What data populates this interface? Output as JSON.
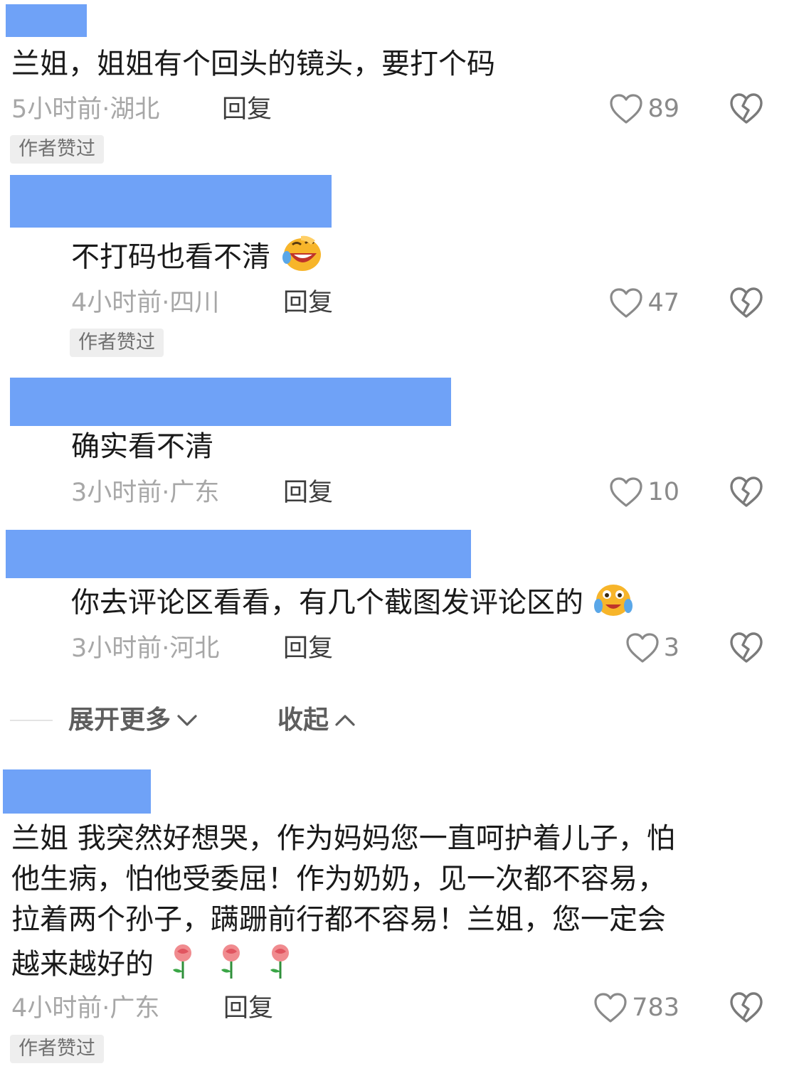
{
  "colors": {
    "redaction": "#6fa2f7",
    "meta_gray": "#a7a7a7",
    "badge_bg": "#eeeeee"
  },
  "comments": [
    {
      "text": "兰姐，姐姐有个回头的镜头，要打个码",
      "meta": "5小时前·湖北",
      "reply": "回复",
      "likes": "89",
      "badge": "作者赞过"
    },
    {
      "text": "不打码也看不清",
      "emoji": "rolling-laughing-emoji",
      "meta": "4小时前·四川",
      "reply": "回复",
      "likes": "47",
      "badge": "作者赞过"
    },
    {
      "text": "确实看不清",
      "meta": "3小时前·广东",
      "reply": "回复",
      "likes": "10"
    },
    {
      "text": "你去评论区看看，有几个截图发评论区的",
      "emoji": "teary-emoji",
      "meta": "3小时前·河北",
      "reply": "回复",
      "likes": "3"
    },
    {
      "text_lines": [
        "兰姐 我突然好想哭，作为妈妈您一直呵护着儿子，怕",
        "他生病，怕他受委屈！作为奶奶，见一次都不容易，",
        "拉着两个孙子，蹒跚前行都不容易！兰姐，您一定会",
        "越来越好的"
      ],
      "emoji": "rose-emoji",
      "meta": "4小时前·广东",
      "reply": "回复",
      "likes": "783",
      "badge": "作者赞过"
    }
  ],
  "thread_controls": {
    "expand_more": "展开更多",
    "collapse": "收起"
  }
}
